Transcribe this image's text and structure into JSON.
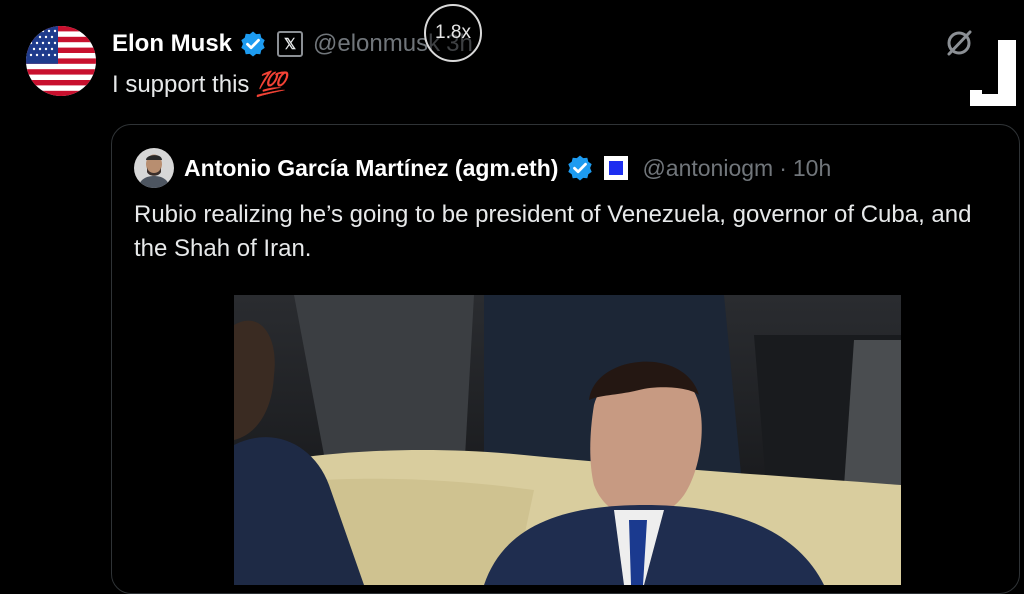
{
  "post": {
    "author_name": "Elon Musk",
    "handle": "@elonmusk",
    "time": "3h",
    "text": "I support this",
    "emoji": "💯"
  },
  "overlay": {
    "speed": "1.8x"
  },
  "quoted": {
    "author_name": "Antonio García Martínez (agm.eth)",
    "handle": "@antoniogm",
    "separator": "·",
    "time": "10h",
    "text": "Rubio realizing he’s going to be president of Venezuela, governor of Cuba, and the Shah of Iran."
  },
  "colors": {
    "verified": "#1d9bf0",
    "background": "#000000",
    "muted": "#71767b",
    "flag_square": "#1d2ef0"
  },
  "icons": [
    "us-flag-avatar",
    "verified-badge-icon",
    "x-logo-icon",
    "no-signal-icon",
    "corner-bracket-icon",
    "quoted-avatar",
    "square-flag-icon"
  ]
}
